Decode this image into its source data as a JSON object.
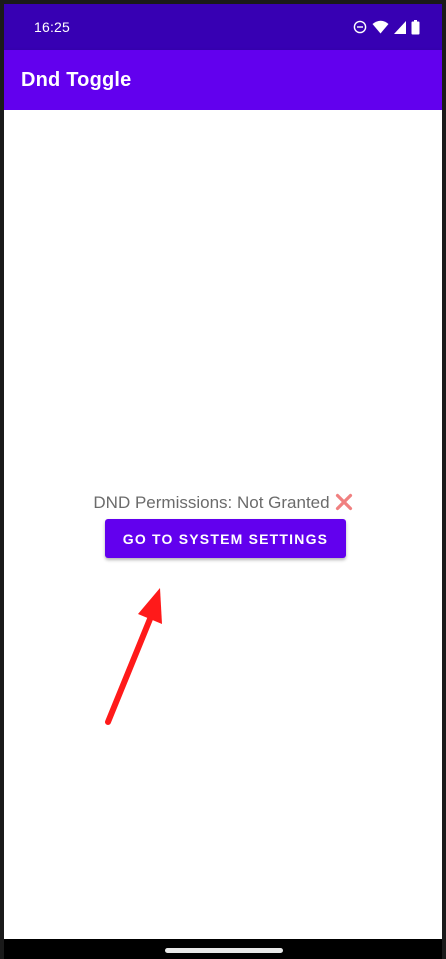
{
  "status_bar": {
    "time": "16:25",
    "icons": [
      "do-not-disturb-icon",
      "wifi-icon",
      "signal-icon",
      "battery-icon"
    ]
  },
  "app_bar": {
    "title": "Dnd Toggle"
  },
  "main": {
    "permission_text": "DND Permissions: Not Granted",
    "permission_icon": "cross-mark-icon",
    "settings_button_label": "GO TO SYSTEM SETTINGS"
  },
  "annotation": {
    "arrow_icon": "red-arrow-icon",
    "arrow_color": "#FF1A1A"
  },
  "colors": {
    "primary": "#6200EE",
    "primary_dark": "#3700B3",
    "cross_mark": "#F08080",
    "text_secondary": "#6B6B6B"
  }
}
